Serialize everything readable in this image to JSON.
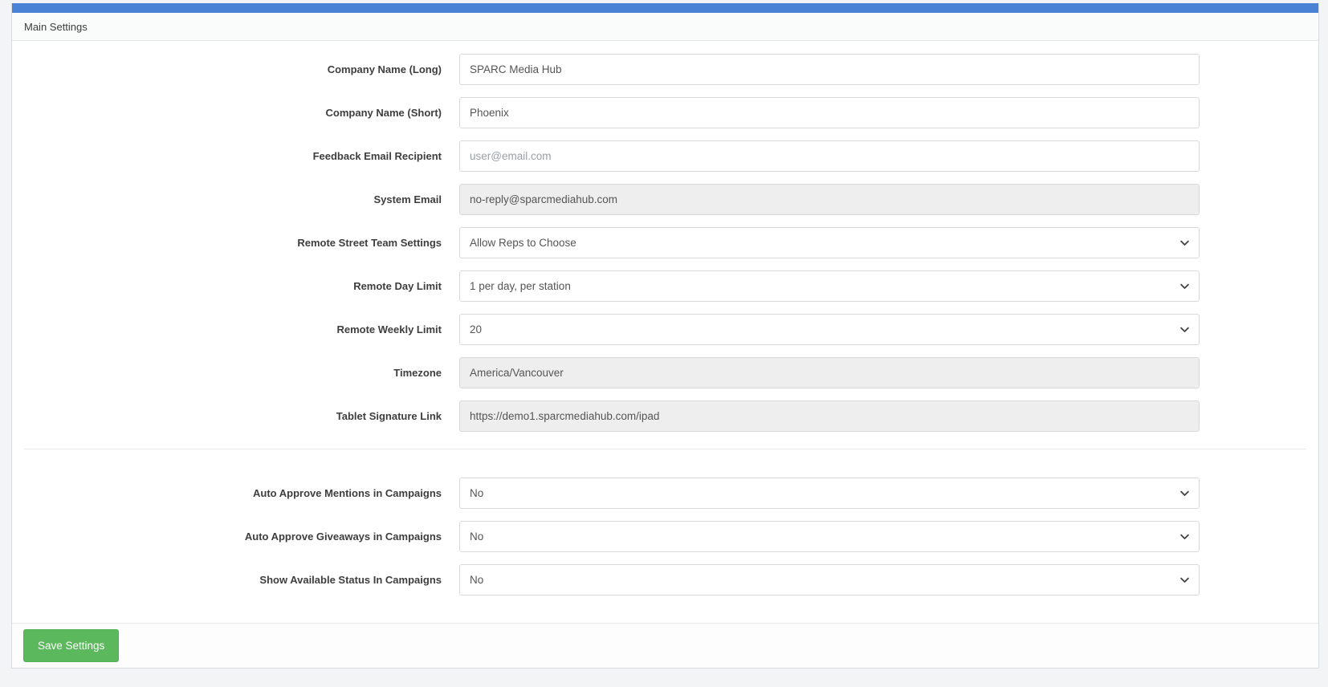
{
  "panel": {
    "title": "Main Settings"
  },
  "colors": {
    "accent_blue": "#4a83d6",
    "save_button_green": "#5cb85c",
    "disabled_field_gray": "#eeeeee"
  },
  "form": {
    "main": [
      {
        "label": "Company Name (Long)",
        "type": "text",
        "value": "SPARC Media Hub"
      },
      {
        "label": "Company Name (Short)",
        "type": "text",
        "value": "Phoenix"
      },
      {
        "label": "Feedback Email Recipient",
        "type": "text",
        "value": "",
        "placeholder": "user@email.com"
      },
      {
        "label": "System Email",
        "type": "text",
        "value": "no-reply@sparcmediahub.com",
        "disabled": true
      },
      {
        "label": "Remote Street Team Settings",
        "type": "select",
        "value": "Allow Reps to Choose"
      },
      {
        "label": "Remote Day Limit",
        "type": "select",
        "value": "1 per day, per station"
      },
      {
        "label": "Remote Weekly Limit",
        "type": "select",
        "value": "20"
      },
      {
        "label": "Timezone",
        "type": "text",
        "value": "America/Vancouver",
        "disabled": true
      },
      {
        "label": "Tablet Signature Link",
        "type": "text",
        "value": "https://demo1.sparcmediahub.com/ipad",
        "disabled": true
      }
    ],
    "campaigns": [
      {
        "label": "Auto Approve Mentions in Campaigns",
        "type": "select",
        "value": "No"
      },
      {
        "label": "Auto Approve Giveaways in Campaigns",
        "type": "select",
        "value": "No"
      },
      {
        "label": "Show Available Status In Campaigns",
        "type": "select",
        "value": "No"
      }
    ]
  },
  "footer": {
    "save_label": "Save Settings"
  }
}
